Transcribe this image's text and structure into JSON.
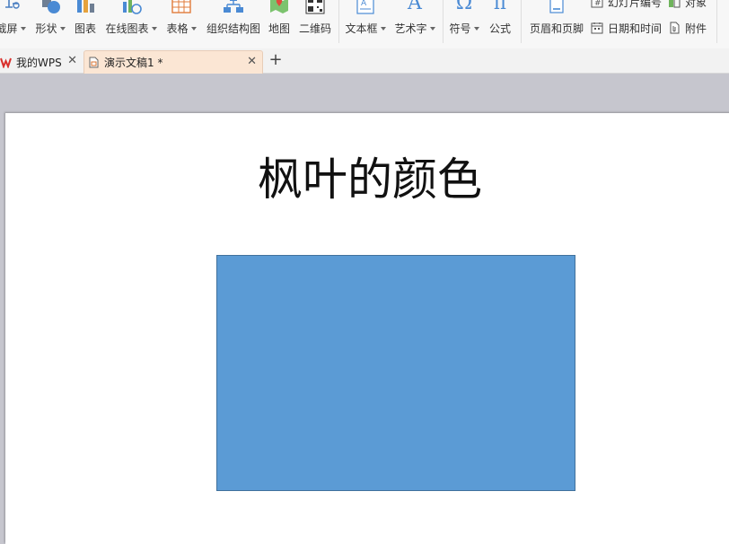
{
  "ribbon": {
    "buttons": [
      {
        "id": "screen",
        "label": "截屏"
      },
      {
        "id": "shape",
        "label": "形状"
      },
      {
        "id": "chart",
        "label": "图表"
      },
      {
        "id": "online-chart",
        "label": "在线图表"
      },
      {
        "id": "table",
        "label": "表格"
      },
      {
        "id": "org-chart",
        "label": "组织结构图"
      },
      {
        "id": "map",
        "label": "地图"
      },
      {
        "id": "qrcode",
        "label": "二维码"
      },
      {
        "id": "textbox",
        "label": "文本框"
      },
      {
        "id": "wordart",
        "label": "艺术字"
      },
      {
        "id": "symbol",
        "label": "符号"
      },
      {
        "id": "formula",
        "label": "公式"
      },
      {
        "id": "header-footer",
        "label": "页眉和页脚"
      }
    ],
    "small": {
      "slide_number": "幻灯片编号",
      "object": "对象",
      "datetime": "日期和时间",
      "attachment": "附件"
    },
    "icons": {
      "omega": "Ω",
      "pi": "π",
      "letter_a": "A"
    }
  },
  "tabs": {
    "home": {
      "label": "我的WPS"
    },
    "doc": {
      "label": "演示文稿1 *"
    },
    "new_symbol": "+",
    "close_symbol": "✕"
  },
  "slide": {
    "title": "枫叶的颜色"
  },
  "colors": {
    "shape_fill": "#5b9bd5",
    "shape_border": "#41719c",
    "active_tab": "#fbe6d4",
    "wps_logo": "#d9302c"
  }
}
